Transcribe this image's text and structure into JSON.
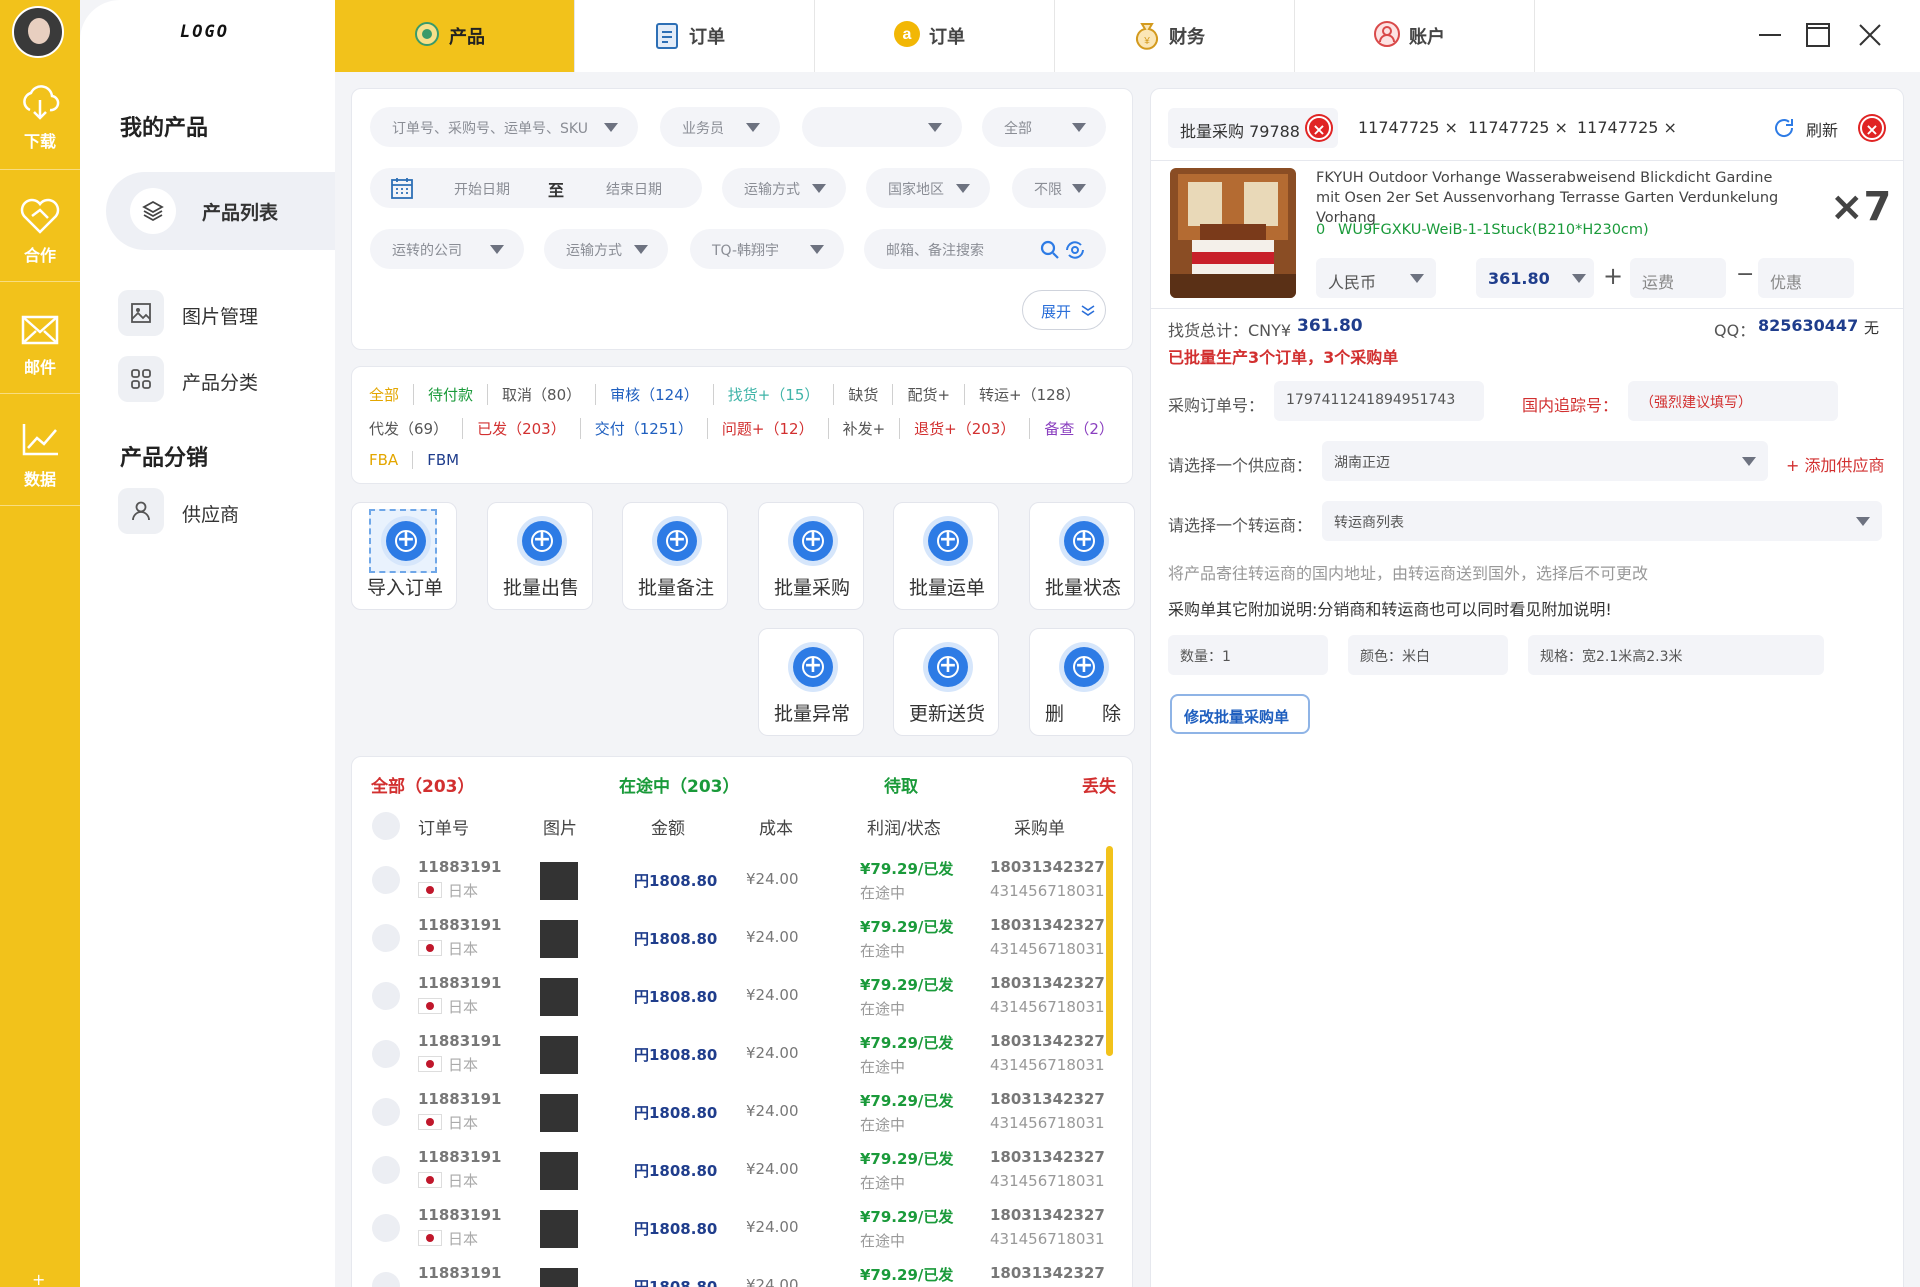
{
  "rail": {
    "items": [
      {
        "label": "下载",
        "icon": "cloud-download-icon"
      },
      {
        "label": "合作",
        "icon": "heart-handshake-icon"
      },
      {
        "label": "邮件",
        "icon": "mail-icon"
      },
      {
        "label": "数据",
        "icon": "chart-line-icon"
      }
    ],
    "bottom": "+"
  },
  "sidebar": {
    "logo": "LOGO",
    "section1": "我的产品",
    "active_item": "产品列表",
    "items": [
      "图片管理",
      "产品分类"
    ],
    "section2": "产品分销",
    "items2": [
      "供应商"
    ]
  },
  "tabs": [
    {
      "label": "产品",
      "icon": "product-icon",
      "active": true
    },
    {
      "label": "订单",
      "icon": "clipboard-icon"
    },
    {
      "label": "订单",
      "icon": "amazon-icon"
    },
    {
      "label": "财务",
      "icon": "money-bag-icon"
    },
    {
      "label": "账户",
      "icon": "user-icon"
    }
  ],
  "filters": {
    "row1": [
      "订单号、采购号、运单号、SKU",
      "业务员",
      "",
      "全部"
    ],
    "start_date": "开始日期",
    "to": "至",
    "end_date": "结束日期",
    "row2": [
      "运输方式",
      "国家地区",
      "不限"
    ],
    "row3": [
      "运转的公司",
      "运输方式",
      "TQ-韩翔宇"
    ],
    "search_placeholder": "邮箱、备注搜索",
    "expand": "展开"
  },
  "status_tags": {
    "row1": [
      {
        "text": "全部",
        "color": "#e3a600"
      },
      {
        "text": "待付款",
        "color": "#1a9a3a"
      },
      {
        "text": "取消（80）",
        "color": "#555555"
      },
      {
        "text": "审核（124）",
        "color": "#1f5fbf"
      },
      {
        "text": "找货+（15）",
        "color": "#3fb4a8"
      },
      {
        "text": "缺货",
        "color": "#555555"
      },
      {
        "text": "配货+",
        "color": "#555555"
      },
      {
        "text": "转运+（128）",
        "color": "#555555"
      }
    ],
    "row2": [
      {
        "text": "代发（69）",
        "color": "#555555"
      },
      {
        "text": "已发（203）",
        "color": "#d23030"
      },
      {
        "text": "交付（1251）",
        "color": "#1f5fbf"
      },
      {
        "text": "问题+（12）",
        "color": "#d23030"
      },
      {
        "text": "补发+",
        "color": "#555555"
      },
      {
        "text": "退货+（203）",
        "color": "#d23030"
      },
      {
        "text": "备查（2）",
        "color": "#8a3fbf"
      }
    ],
    "row3": [
      {
        "text": "FBA",
        "color": "#e3a600"
      },
      {
        "text": "FBM",
        "color": "#1f3d8c"
      }
    ]
  },
  "actions": [
    "导入订单",
    "批量出售",
    "批量备注",
    "批量采购",
    "批量运单",
    "批量状态",
    "批量异常",
    "更新送货",
    "删　　除"
  ],
  "orders": {
    "tabs": [
      {
        "text": "全部（203）",
        "color": "#d23030"
      },
      {
        "text": "在途中（203）",
        "color": "#1a9a3a"
      },
      {
        "text": "待取",
        "color": "#1a9a3a"
      },
      {
        "text": "丢失",
        "color": "#d23030"
      }
    ],
    "columns": [
      "订单号",
      "图片",
      "金额",
      "成本",
      "利润/状态",
      "采购单"
    ],
    "rows": [
      {
        "id": "11883191",
        "country": "日本",
        "amount": "円1808.80",
        "cost": "¥24.00",
        "profit": "¥79.29/已发",
        "status": "在途中",
        "po": "18031342327",
        "po2": "431456718031"
      },
      {
        "id": "11883191",
        "country": "日本",
        "amount": "円1808.80",
        "cost": "¥24.00",
        "profit": "¥79.29/已发",
        "status": "在途中",
        "po": "18031342327",
        "po2": "431456718031"
      },
      {
        "id": "11883191",
        "country": "日本",
        "amount": "円1808.80",
        "cost": "¥24.00",
        "profit": "¥79.29/已发",
        "status": "在途中",
        "po": "18031342327",
        "po2": "431456718031"
      },
      {
        "id": "11883191",
        "country": "日本",
        "amount": "円1808.80",
        "cost": "¥24.00",
        "profit": "¥79.29/已发",
        "status": "在途中",
        "po": "18031342327",
        "po2": "431456718031"
      },
      {
        "id": "11883191",
        "country": "日本",
        "amount": "円1808.80",
        "cost": "¥24.00",
        "profit": "¥79.29/已发",
        "status": "在途中",
        "po": "18031342327",
        "po2": "431456718031"
      },
      {
        "id": "11883191",
        "country": "日本",
        "amount": "円1808.80",
        "cost": "¥24.00",
        "profit": "¥79.29/已发",
        "status": "在途中",
        "po": "18031342327",
        "po2": "431456718031"
      },
      {
        "id": "11883191",
        "country": "日本",
        "amount": "円1808.80",
        "cost": "¥24.00",
        "profit": "¥79.29/已发",
        "status": "在途中",
        "po": "18031342327",
        "po2": "431456718031"
      },
      {
        "id": "11883191",
        "country": "日本",
        "amount": "円1808.80",
        "cost": "¥24.00",
        "profit": "¥79.29/已发",
        "status": "在途中",
        "po": "18031342327",
        "po2": "431456718031"
      }
    ]
  },
  "detail": {
    "batch_tab": "批量采购 79788",
    "tabs": [
      "11747725 ×",
      "11747725 ×",
      "11747725 ×"
    ],
    "refresh": "刷新",
    "product_title": "FKYUH Outdoor Vorhange Wasserabweisend Blickdicht Gardine mit Osen 2er Set Aussenvorhang Terrasse Garten Verdunkelung Vorhang",
    "sku_prefix": "0",
    "sku": "WU9FGXKU-WeiB-1-1Stuck(B210*H230cm)",
    "qty_mult": "×7",
    "currency": "人民币",
    "price": "361.80",
    "plus": "+",
    "shipping": "运费",
    "minus": "−",
    "discount": "优惠",
    "total_label": "找货总计：CNY¥",
    "total_value": "361.80",
    "qq_label": "QQ：",
    "qq_value": "825630447",
    "none": "无",
    "produced_note": "已批量生产3个订单，3个采购单",
    "po_label": "采购订单号：",
    "po_value": "1797411241894951743",
    "tracking_label": "国内追踪号：",
    "tracking_placeholder": "（强烈建议填写）",
    "supplier_label": "请选择一个供应商：",
    "supplier_value": "湖南正迈",
    "add_supplier": "+ 添加供应商",
    "forwarder_label": "请选择一个转运商：",
    "forwarder_value": "转运商列表",
    "hint": "将产品寄往转运商的国内地址，由转运商送到国外，选择后不可更改",
    "note": "采购单其它附加说明:分销商和转运商也可以同时看见附加说明!",
    "qty": "数量：1",
    "color": "颜色：米白",
    "spec": "规格：宽2.1米高2.3米",
    "modify": "修改批量采购单"
  }
}
